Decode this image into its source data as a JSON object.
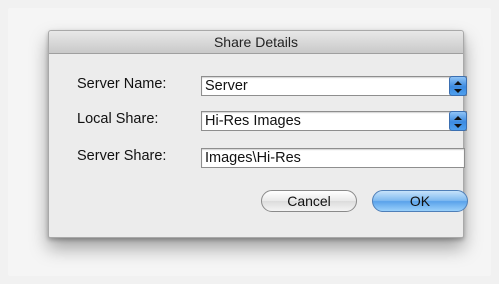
{
  "dialog": {
    "title": "Share Details",
    "server_name_label": "Server Name:",
    "server_name_value": "Server",
    "local_share_label": "Local Share:",
    "local_share_value": "Hi-Res Images",
    "server_share_label": "Server Share:",
    "server_share_value": "Images\\Hi-Res",
    "cancel_label": "Cancel",
    "ok_label": "OK"
  },
  "colors": {
    "accent": "#5aa2ea",
    "dialog_background": "#ececec"
  },
  "icons": {
    "combo_arrow": "up-down-arrows-icon"
  }
}
